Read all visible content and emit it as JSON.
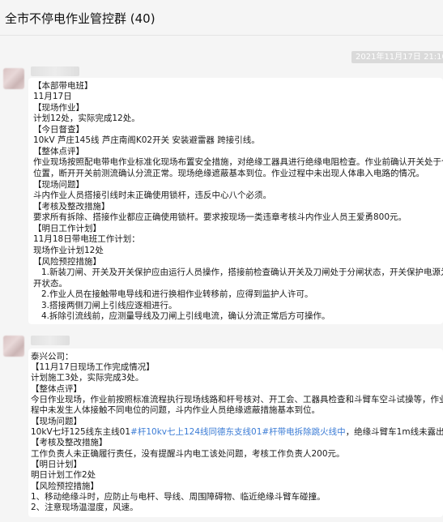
{
  "window": {
    "title": "全市不停电作业管控群 (40)"
  },
  "divider_time": "2021年11月17日 21:10",
  "messages": [
    {
      "lines": [
        "【本部带电班】",
        "11月17日",
        "【现场作业】",
        "计划12处，实际完成12处。",
        "【今日督查】",
        "10kV 芦庄145线 芦庄南阁K02开关 安装避雷器 跨接引线。",
        "【整体点评】",
        "作业现场按照配电带电作业标准化现场布置安全措施，对绝缘工器具进行绝缘电阻检查。作业前确认开关处于合闸",
        "位置，断开开关前测流确认分流正常。现场绝缘遮蔽基本到位。作业过程中未出现人体串入电路的情况。",
        "【现场问题】",
        "斗内作业人员搭接引线时未正确使用锁杆，违反中心八个必须。",
        "【考核及整改措施】",
        "要求所有拆除、搭接作业都应正确使用锁杆。要求按现场一类违章考核斗内作业人员王爱勇800元。",
        "【明日工作计划】",
        "11月18日带电班工作计划：",
        "现场作业计划12处",
        "【风险预控措施】",
        "1.新装刀闸、开关及开关保护应由运行人员操作，搭接前检查确认开关及刀闸处于分闸状态，开关保护电源为断",
        "开状态。",
        "2.作业人员在接触带电导线和进行换相作业转移前，应得到监护人许可。",
        "3.搭接两侧刀闸上引线应逐相进行。",
        "4.拆除引流线前，应测量导线及刀闸上引线电流，确认分流正常后方可操作。"
      ]
    },
    {
      "lines": [
        "泰兴公司：",
        "【11月17日现场工作完成情况】",
        "计划施工3处，实际完成3处。",
        "【整体点评】",
        "今日作业现场，作业前按照标准流程执行现场线路和杆号核对、开工会、工器具检查和斗臂车空斗试操等，作业过",
        "程中未发生人体接触不同电位的问题，斗内作业人员绝缘遮蔽措施基本到位。",
        "【现场问题】",
        "10kV七圩125线东主线01",
        "#杆10kv七上124线同德东支线01#杆带电拆除跳火线中",
        "，绝缘斗臂车1m线未露出。",
        "【考核及整改措施】",
        "工作负责人未正确履行责任，没有提醒斗内电工该处问题，考核工作负责人200元。",
        "【明日计划】",
        "明日计划工作2处",
        "【风险预控措施】",
        "1、移动绝缘斗时，应防止与电杆、导线、周围障碍物、临近绝缘斗臂车碰撞。",
        "2、注意现场温湿度，风速。"
      ]
    }
  ],
  "colors": {
    "link": "#3a7bd5",
    "background": "#f5f5f5",
    "bubble": "#ffffff"
  }
}
